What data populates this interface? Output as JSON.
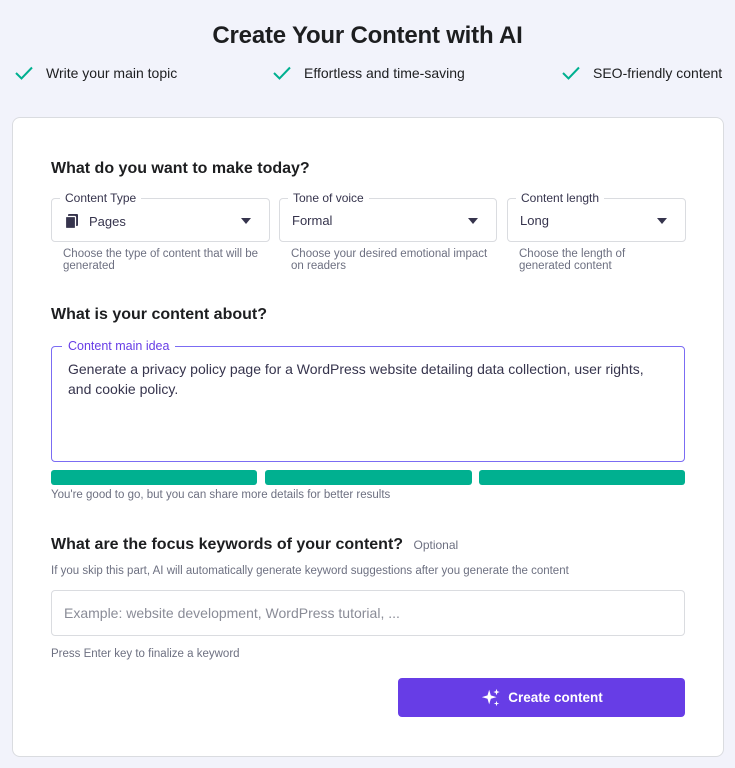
{
  "header": {
    "title": "Create Your Content with AI",
    "features": [
      "Write your main topic",
      "Effortless and time-saving",
      "SEO-friendly content"
    ]
  },
  "colors": {
    "accent": "#673de6",
    "check": "#00b090",
    "progress": "#00b090"
  },
  "form": {
    "section1_title": "What do you want to make today?",
    "content_type": {
      "label": "Content Type",
      "value": "Pages",
      "icon": "pages-icon",
      "help": "Choose the type of content that will be generated"
    },
    "tone": {
      "label": "Tone of voice",
      "value": "Formal",
      "help": "Choose your desired emotional impact on readers"
    },
    "length": {
      "label": "Content length",
      "value": "Long",
      "help": "Choose the length of generated content"
    },
    "section2_title": "What is your content about?",
    "main_idea": {
      "label": "Content main idea",
      "value": "Generate a privacy policy page for a WordPress website detailing data collection, user rights, and cookie policy."
    },
    "quality_segments": 3,
    "quality_filled": 3,
    "quality_message": "You're good to go, but you can share more details for better results",
    "section3_title": "What are the focus keywords of your content?",
    "section3_optional": "Optional",
    "keywords_help": "If you skip this part, AI will automatically generate keyword suggestions after you generate the content",
    "keywords_placeholder": "Example: website development, WordPress tutorial, ...",
    "keywords_hint": "Press Enter key to finalize a keyword",
    "submit_label": "Create content",
    "submit_icon": "sparkles-icon"
  }
}
